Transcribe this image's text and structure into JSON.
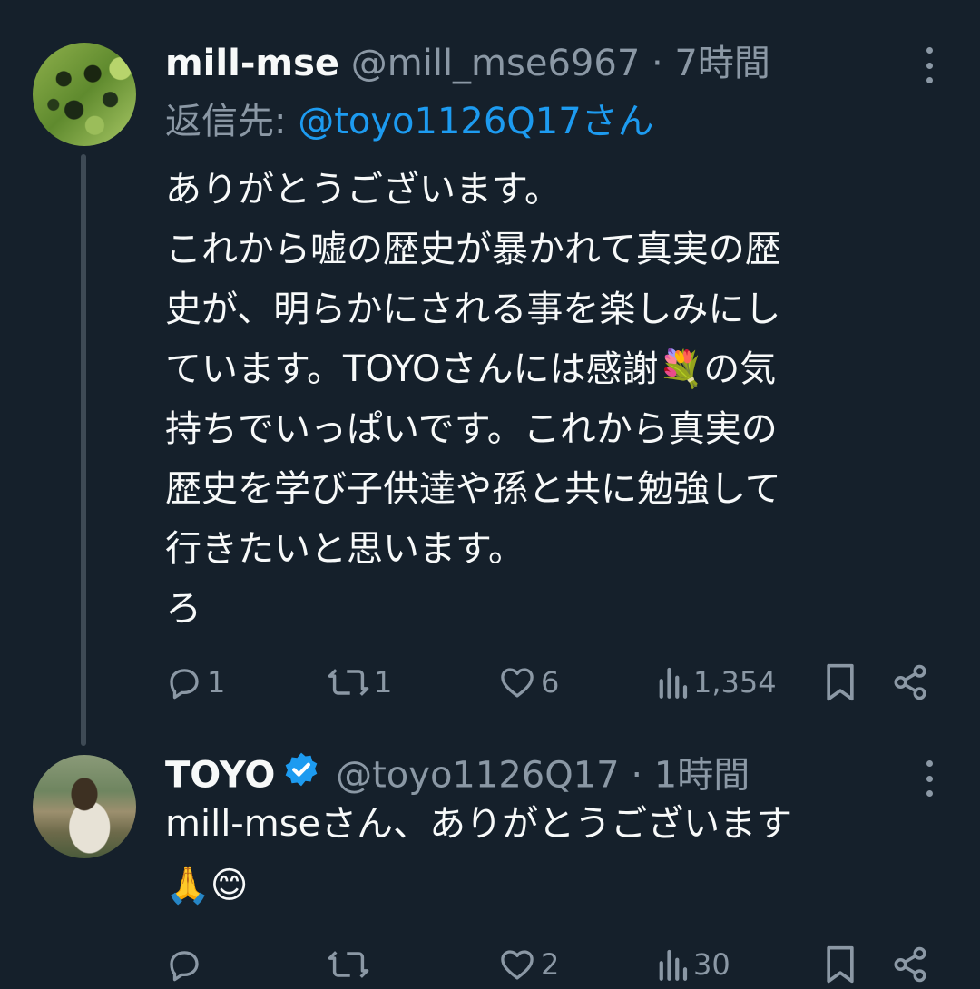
{
  "tweets": [
    {
      "display_name": "mill-mse",
      "handle": "@mill_mse6967",
      "time": "· 7時間",
      "reply_label": "返信先: ",
      "reply_mention": "@toyo1126Q17さん",
      "text": "ありがとうございます。\nこれから嘘の歴史が暴かれて真実の歴\n史が、明らかにされる事を楽しみにし\nています。TOYOさんには感謝💐の気\n持ちでいっぱいです。これから真実の\n歴史を学び子供達や孫と共に勉強して\n行きたいと思います。\nろ",
      "replies": "1",
      "retweets": "1",
      "likes": "6",
      "views": "1,354"
    },
    {
      "display_name": "TOYO",
      "handle": "@toyo1126Q17",
      "time": "· 1時間",
      "text": "mill-mseさん、ありがとうございます\n🙏😊",
      "replies": "",
      "retweets": "",
      "likes": "2",
      "views": "30",
      "verified": true
    }
  ],
  "colors": {
    "background": "#15202b",
    "text": "#f7f9f9",
    "secondary": "#8b98a5",
    "accent": "#1d9bf0",
    "thread_line": "#3e4a55"
  }
}
